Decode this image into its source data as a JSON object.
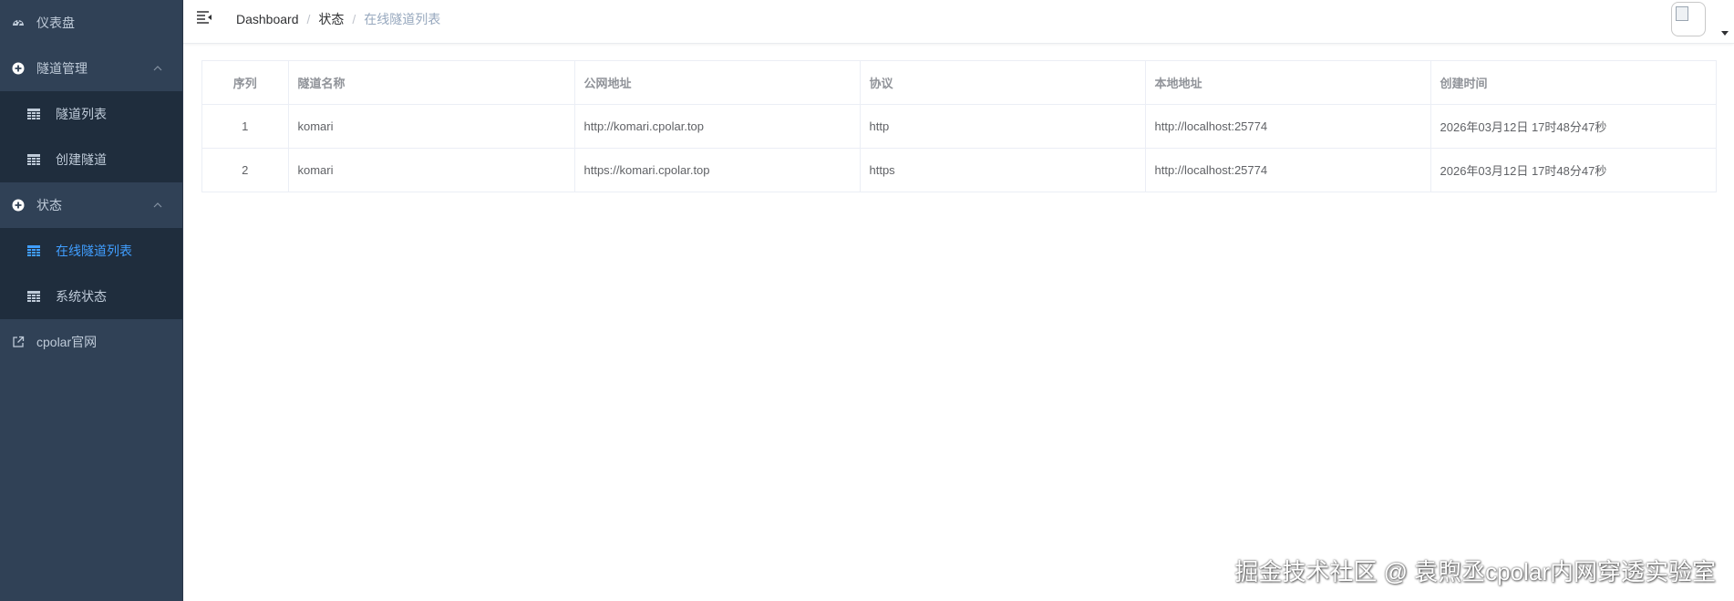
{
  "sidebar": {
    "items": [
      {
        "label": "仪表盘",
        "icon": "dashboard-icon",
        "has_chevron": false
      },
      {
        "label": "隧道管理",
        "icon": "plus-circle-icon",
        "has_chevron": true,
        "children": [
          {
            "label": "隧道列表",
            "icon": "table-icon",
            "active": false
          },
          {
            "label": "创建隧道",
            "icon": "table-icon",
            "active": false
          }
        ]
      },
      {
        "label": "状态",
        "icon": "plus-circle-icon",
        "has_chevron": true,
        "children": [
          {
            "label": "在线隧道列表",
            "icon": "table-icon",
            "active": true
          },
          {
            "label": "系统状态",
            "icon": "table-icon",
            "active": false
          }
        ]
      },
      {
        "label": "cpolar官网",
        "icon": "external-link-icon",
        "has_chevron": false
      }
    ]
  },
  "navbar": {
    "breadcrumb": [
      "Dashboard",
      "状态",
      "在线隧道列表"
    ]
  },
  "table": {
    "headers": [
      "序列",
      "隧道名称",
      "公网地址",
      "协议",
      "本地地址",
      "创建时间"
    ],
    "rows": [
      [
        "1",
        "komari",
        "http://komari.cpolar.top",
        "http",
        "http://localhost:25774",
        "2026年03月12日 17时48分47秒"
      ],
      [
        "2",
        "komari",
        "https://komari.cpolar.top",
        "https",
        "http://localhost:25774",
        "2026年03月12日 17时48分47秒"
      ]
    ]
  },
  "watermark": "掘金技术社区 @ 袁煦丞cpolar内网穿透实验室",
  "colors": {
    "sidebar_bg": "#304156",
    "submenu_bg": "#1f2d3d",
    "menu_text": "#bfcbd9",
    "active": "#409eff"
  }
}
